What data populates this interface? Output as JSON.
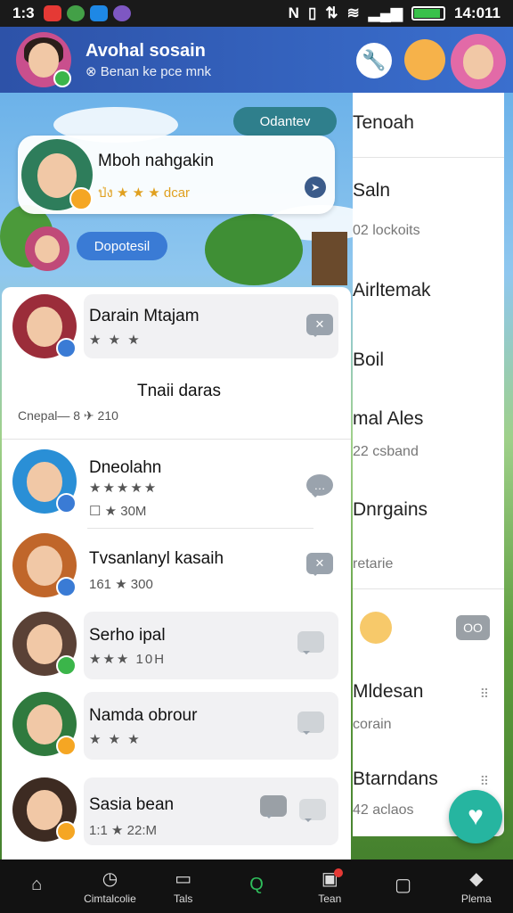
{
  "status_bar": {
    "time": "1:3",
    "clock": "14:011"
  },
  "header": {
    "name": "Avohal sosain",
    "subtitle": "Benan ke pce mnk"
  },
  "top_chat": {
    "pill_top": "Odantev",
    "card_name": "Mboh nahgakin",
    "card_meta": "ป่ง ★ ★ ★ dcar",
    "pill_bottom": "Dopotesil"
  },
  "right_panel": {
    "items": [
      {
        "label": "Tenoah",
        "sub": ""
      },
      {
        "label": "Saln",
        "sub": "02 lockoits"
      },
      {
        "label": "Airltemak",
        "sub": ""
      },
      {
        "label": "Boil",
        "sub": ""
      },
      {
        "label": "mal Ales",
        "sub": "22 csband"
      },
      {
        "label": "Dnrgains",
        "sub": "retarie"
      },
      {
        "label": "Mldesan",
        "sub": "corain"
      },
      {
        "label": "Btarndans",
        "sub": "42 aclaos"
      }
    ],
    "emoji_box": "OO"
  },
  "list": {
    "rows": [
      {
        "name": "Darain Mtajam",
        "meta": "★ ★ ★",
        "extra_name": "Tnaii daras",
        "extra_meta": "Cnepal— 8  ✈ 210"
      },
      {
        "name": "Dneolahn",
        "meta": "★★★★★",
        "sub": "☐  ★ 30M"
      },
      {
        "name": "Tvsanlanyl kasaih",
        "meta": "161 ★ 300"
      },
      {
        "name": "Serho ipal",
        "meta": "★★★ 10H"
      },
      {
        "name": "Namda obrour",
        "meta": "★ ★ ★"
      },
      {
        "name": "Sasia bean",
        "meta": "1:1 ★ 22:M"
      }
    ]
  },
  "bottom_nav": [
    {
      "label": "",
      "icon": "home-icon"
    },
    {
      "label": "Cimtalcolie",
      "icon": "clock-icon"
    },
    {
      "label": "Tals",
      "icon": "box-icon"
    },
    {
      "label": "",
      "icon": "search-icon"
    },
    {
      "label": "Tean",
      "icon": "inbox-icon"
    },
    {
      "label": "",
      "icon": "square-icon"
    },
    {
      "label": "Plema",
      "icon": "heart-box-icon"
    }
  ],
  "colors": {
    "header": "#2d52a8",
    "accent": "#26b5a0",
    "star": "#f2b21c",
    "nav_active": "#2fbf5c"
  }
}
